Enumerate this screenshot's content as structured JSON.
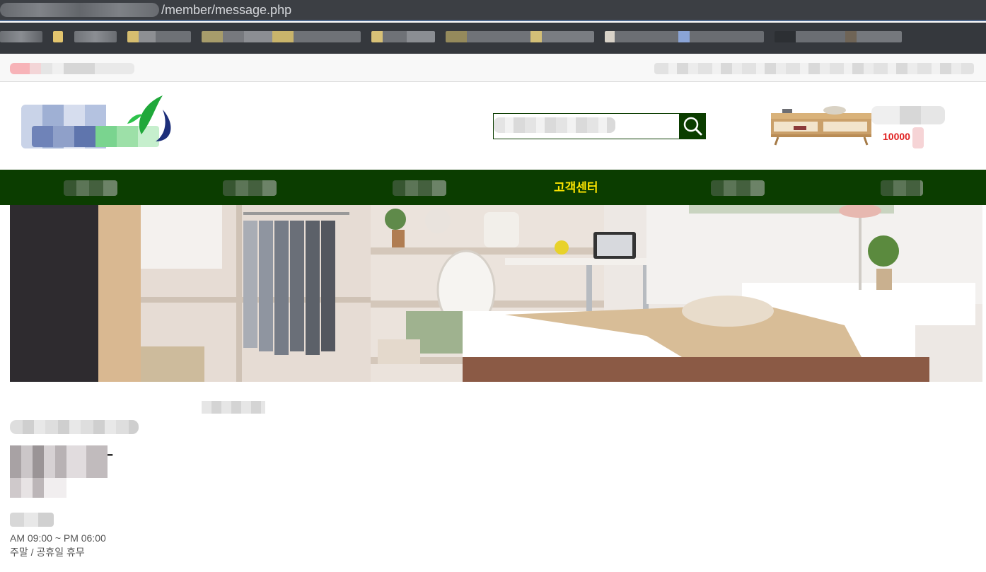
{
  "browser": {
    "url_text": "/member/message.php"
  },
  "header": {
    "promo_price": "10000"
  },
  "nav": {
    "active_label": "고객센터"
  },
  "contact": {
    "phone_visible": "7-",
    "hours": "AM 09:00 ~ PM 06:00",
    "holiday": "주말 / 공휴일 휴무"
  },
  "icons": {
    "search": "search-icon",
    "logo": "logo-icon"
  },
  "colors": {
    "nav_bg": "#0b3d00",
    "nav_active": "#ffe600",
    "price": "#e02020"
  }
}
